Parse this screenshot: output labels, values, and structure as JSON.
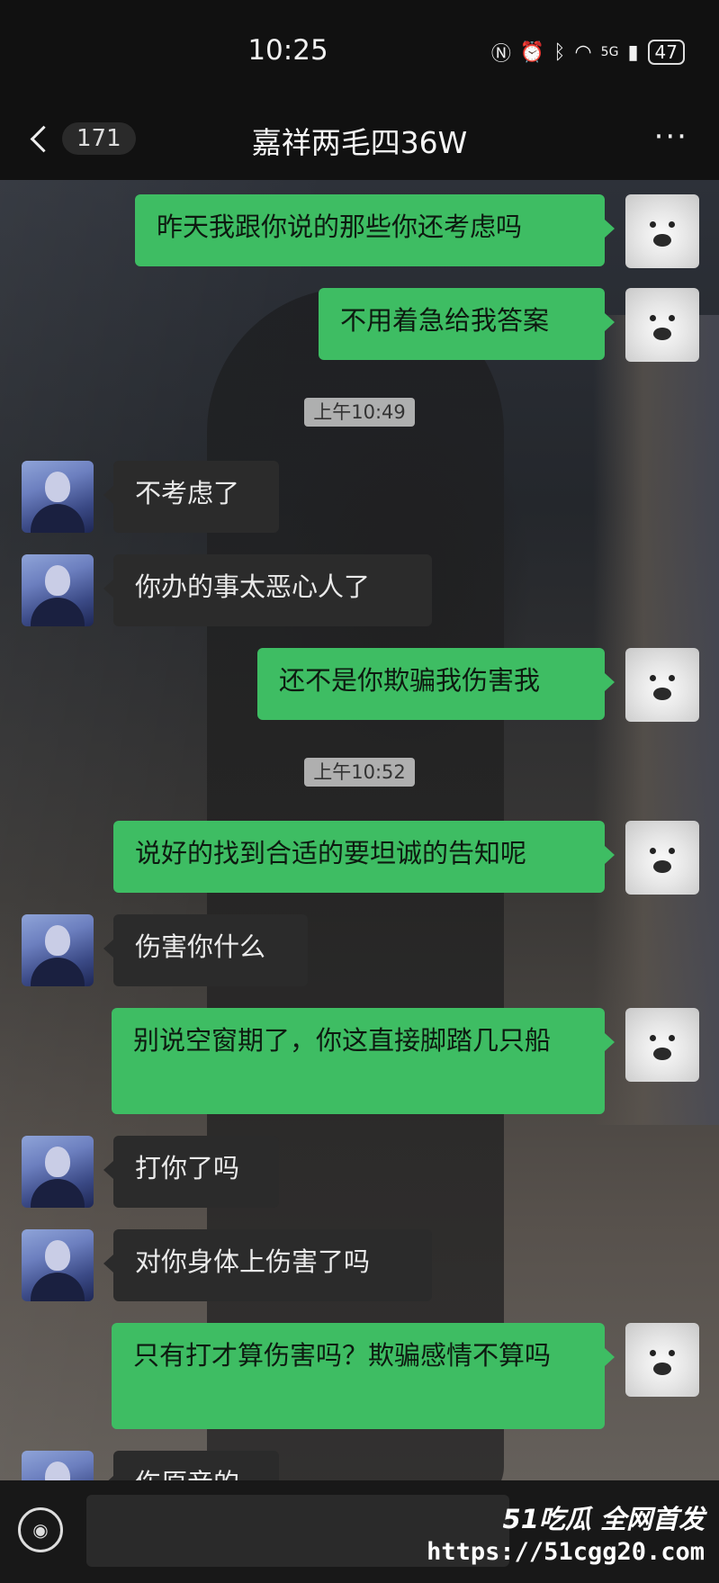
{
  "status_bar": {
    "time": "10:25",
    "network": "5G",
    "battery": "47"
  },
  "header": {
    "back_badge": "171",
    "title": "嘉祥两毛四36W",
    "more": "···"
  },
  "messages": [
    {
      "side": "out",
      "text": "昨天我跟你说的那些你还考虑吗"
    },
    {
      "side": "out",
      "text": "不用着急给我答案"
    },
    {
      "type": "time",
      "text": "上午10:49"
    },
    {
      "side": "in",
      "text": "不考虑了"
    },
    {
      "side": "in",
      "text": "你办的事太恶心人了"
    },
    {
      "side": "out",
      "text": "还不是你欺骗我伤害我"
    },
    {
      "type": "time",
      "text": "上午10:52"
    },
    {
      "side": "out",
      "text": "说好的找到合适的要坦诚的告知呢"
    },
    {
      "side": "in",
      "text": "伤害你什么"
    },
    {
      "side": "out",
      "text": "别说空窗期了，你这直接脚踏几只船"
    },
    {
      "side": "in",
      "text": "打你了吗"
    },
    {
      "side": "in",
      "text": "对你身体上伤害了吗"
    },
    {
      "side": "out",
      "text": "只有打才算伤害吗？欺骗感情不算吗"
    },
    {
      "side": "in",
      "text": "伤原音的"
    }
  ],
  "watermark": {
    "line1": "51吃瓜 全网首发",
    "line2": "https://51cgg20.com"
  },
  "colors": {
    "outgoing": "#3ebd63",
    "incoming": "#2b2b2b"
  },
  "icons": {
    "voice": "voice-icon",
    "back": "chevron-left-icon"
  }
}
